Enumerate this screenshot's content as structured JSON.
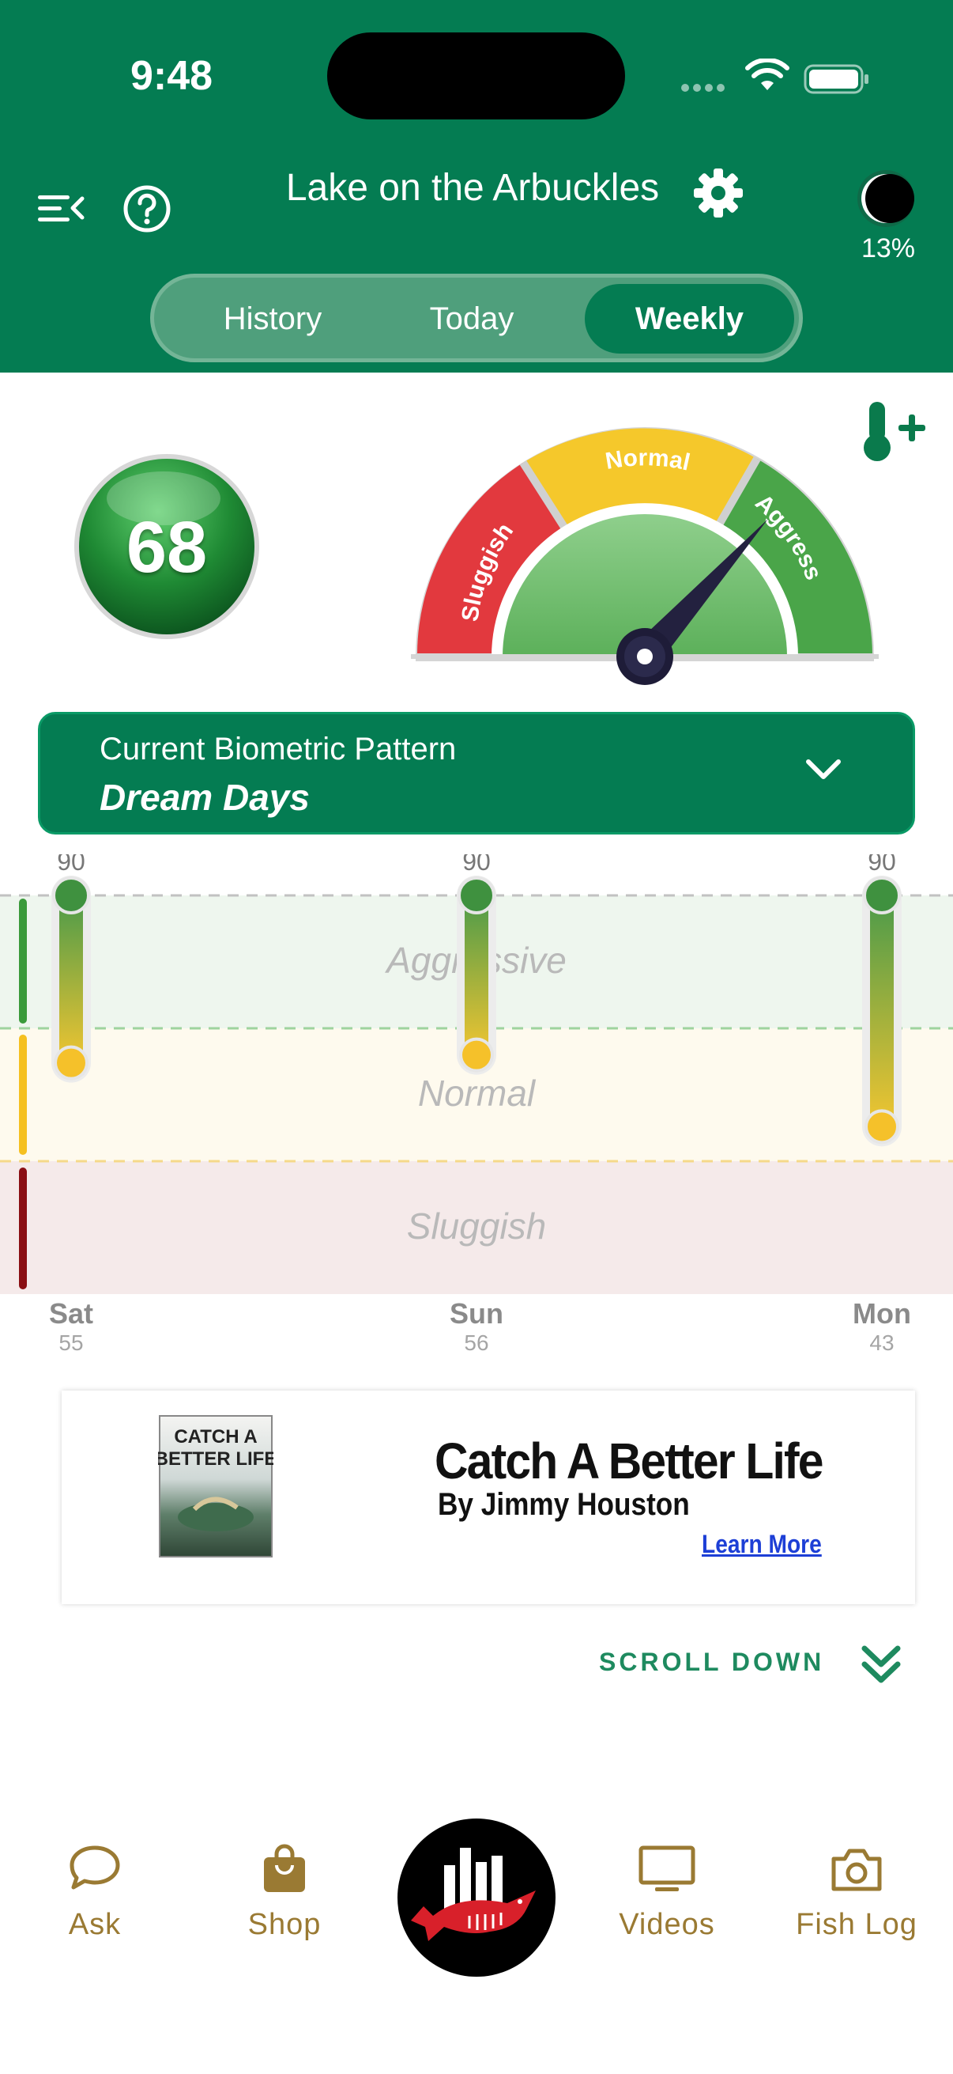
{
  "status_bar": {
    "time": "9:48"
  },
  "header": {
    "title": "Lake on the Arbuckles",
    "moon_phase_percent": "13%",
    "tabs": [
      "History",
      "Today",
      "Weekly"
    ],
    "active_tab": "Weekly"
  },
  "score": {
    "value": "68"
  },
  "gauge": {
    "zones": [
      "Sluggish",
      "Normal",
      "Aggressive"
    ],
    "needle_zone": "Aggressive",
    "colors": {
      "sluggish": "#e2393e",
      "normal": "#f5c82b",
      "aggressive": "#4aa549"
    }
  },
  "pattern": {
    "label": "Current Biometric Pattern",
    "value": "Dream Days"
  },
  "chart_data": {
    "type": "range",
    "zones": [
      "Aggressive",
      "Normal",
      "Sluggish"
    ],
    "days": [
      {
        "day": "Sat",
        "temp": "55",
        "high": 90,
        "high_label": "90",
        "low_level": 0.58
      },
      {
        "day": "Sun",
        "temp": "56",
        "high": 90,
        "high_label": "90",
        "low_level": 0.6
      },
      {
        "day": "Mon",
        "temp": "43",
        "high": 90,
        "high_label": "90",
        "low_level": 0.42
      }
    ]
  },
  "ad": {
    "book_text": "CATCH A BETTER LIFE",
    "title": "Catch A Better Life",
    "subtitle": "By Jimmy Houston",
    "link": "Learn More"
  },
  "scroll_hint": "SCROLL DOWN",
  "tabbar": {
    "ask": "Ask",
    "shop": "Shop",
    "videos": "Videos",
    "fish_log": "Fish Log"
  },
  "colors": {
    "brand_green": "#047c52",
    "gold": "#9a7a33"
  }
}
